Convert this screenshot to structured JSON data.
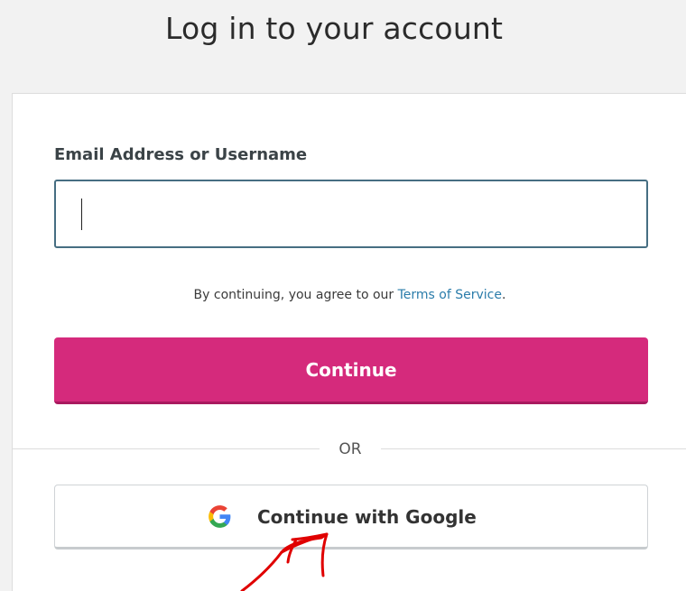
{
  "header": {
    "title": "Log in to your account"
  },
  "login_form": {
    "email_label": "Email Address or Username",
    "email_value": "",
    "email_placeholder": "",
    "terms_prefix": "By continuing, you agree to our ",
    "terms_link": "Terms of Service",
    "terms_suffix": ".",
    "continue_label": "Continue",
    "divider_label": "OR",
    "google_label": "Continue with Google"
  },
  "icons": {
    "google": "google-g-logo"
  },
  "colors": {
    "background": "#f2f2f2",
    "card": "#ffffff",
    "primary_button": "#d52a7c",
    "input_border": "#466e82",
    "link": "#2a7caa",
    "annotation_arrow": "#e00000"
  }
}
